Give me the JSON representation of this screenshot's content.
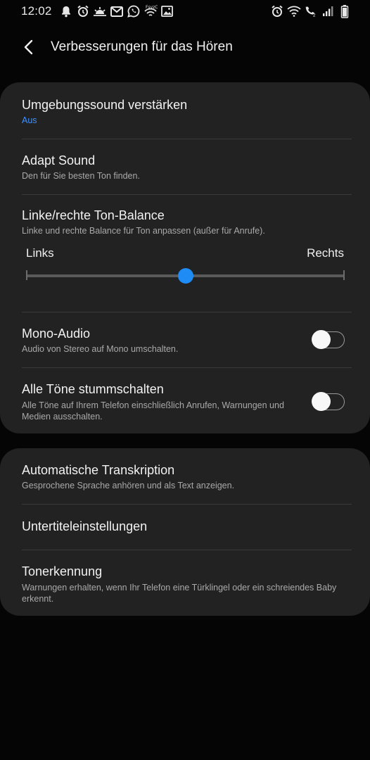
{
  "status_bar": {
    "time": "12:02",
    "left_icons": [
      "bell-icon",
      "alarm-clock-icon",
      "weather-sunrise-icon",
      "gmail-icon",
      "whatsapp-icon",
      "wifi-calling-icon",
      "gallery-icon"
    ],
    "right_icons": [
      "alarm-clock-icon",
      "wifi-icon",
      "volte-call-icon",
      "signal-icon",
      "battery-icon"
    ]
  },
  "header": {
    "title": "Verbesserungen für das Hören"
  },
  "card1": {
    "items": [
      {
        "title": "Umgebungssound verstärken",
        "subtitle": "Aus"
      },
      {
        "title": "Adapt Sound",
        "subtitle": "Den für Sie besten Ton finden."
      },
      {
        "title": "Linke/rechte Ton-Balance",
        "subtitle": "Linke und rechte Balance für Ton anpassen (außer für Anrufe)."
      },
      {
        "title": "Mono-Audio",
        "subtitle": "Audio von Stereo auf Mono umschalten.",
        "enabled": false
      },
      {
        "title": "Alle Töne stummschalten",
        "subtitle": "Alle Töne auf Ihrem Telefon einschließlich Anrufen, Warnungen und Medien ausschalten.",
        "enabled": false
      }
    ],
    "balance": {
      "left_label": "Links",
      "right_label": "Rechts",
      "value": 0.5
    }
  },
  "card2": {
    "items": [
      {
        "title": "Automatische Transkription",
        "subtitle": "Gesprochene Sprache anhören und als Text anzeigen."
      },
      {
        "title": "Untertiteleinstellungen"
      },
      {
        "title": "Tonerkennung",
        "subtitle": "Warnungen erhalten, wenn Ihr Telefon eine Türklingel oder ein schreiendes Baby erkennt."
      }
    ]
  },
  "colors": {
    "accent": "#3e91ff",
    "slider_thumb": "#1f8bf5",
    "card_bg": "#222222",
    "page_bg": "#050505"
  }
}
